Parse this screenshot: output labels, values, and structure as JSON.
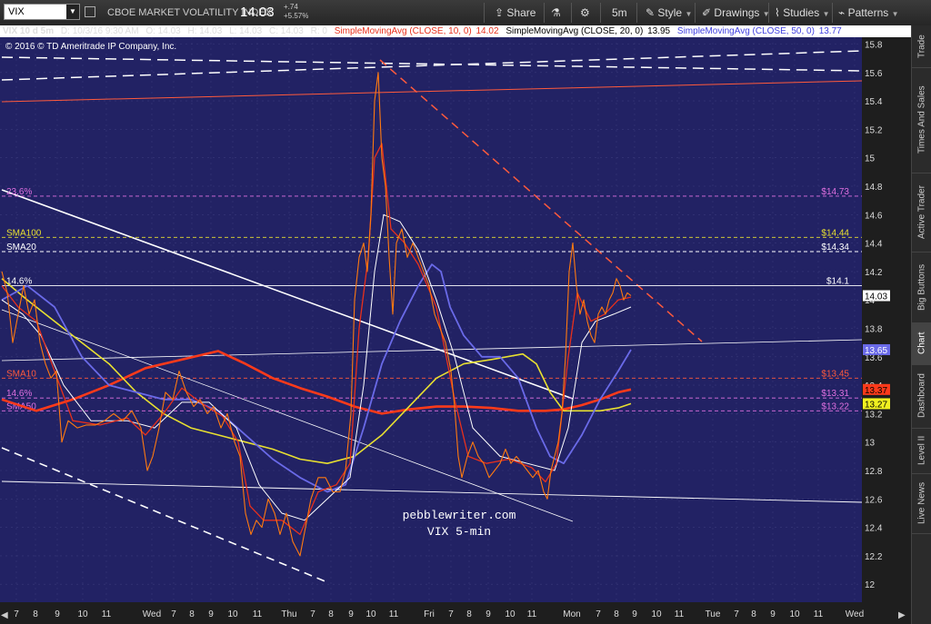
{
  "toolbar": {
    "symbol": "VIX",
    "description": "CBOE MARKET VOLATILITY INDEX",
    "last": "14.03",
    "change": "+.74",
    "change_pct": "+5.57%",
    "share": "Share",
    "timeframe": "5m",
    "style": "Style",
    "drawings": "Drawings",
    "studies": "Studies",
    "patterns": "Patterns"
  },
  "infobar": {
    "symbol": "VIX 10 d 5m",
    "date": "D: 10/3/16 9:30 AM",
    "open": "O: 14.03",
    "high": "H: 14.03",
    "low": "L: 14.03",
    "close": "C: 14.03",
    "r": "R: 0",
    "sma10": "SimpleMovingAvg (CLOSE, 10, 0)",
    "sma10_val": "14.02",
    "sma20": "SimpleMovingAvg (CLOSE, 20, 0)",
    "sma20_val": "13.95",
    "sma50": "SimpleMovingAvg (CLOSE, 50, 0)",
    "sma50_val": "13.77"
  },
  "copyright": "© 2016 © TD Ameritrade IP Company, Inc.",
  "watermark": {
    "line1": "pebblewriter.com",
    "line2": "VIX 5-min"
  },
  "chart_data": {
    "type": "line",
    "y_ticks": [
      "15.8",
      "15.6",
      "15.4",
      "15.2",
      "15",
      "14.8",
      "14.6",
      "14.4",
      "14.2",
      "14",
      "13.8",
      "13.6",
      "13.4",
      "13.2",
      "13",
      "12.8",
      "12.6",
      "12.4",
      "12.2",
      "12"
    ],
    "x_labels": [
      {
        "t": "7",
        "pos": 18
      },
      {
        "t": "8",
        "pos": 39
      },
      {
        "t": "9",
        "pos": 63
      },
      {
        "t": "10",
        "pos": 91
      },
      {
        "t": "11",
        "pos": 117
      },
      {
        "t": "Wed",
        "pos": 167
      },
      {
        "t": "7",
        "pos": 191
      },
      {
        "t": "8",
        "pos": 211
      },
      {
        "t": "9",
        "pos": 232
      },
      {
        "t": "10",
        "pos": 256
      },
      {
        "t": "11",
        "pos": 283
      },
      {
        "t": "Thu",
        "pos": 318
      },
      {
        "t": "7",
        "pos": 344
      },
      {
        "t": "8",
        "pos": 364
      },
      {
        "t": "9",
        "pos": 386
      },
      {
        "t": "10",
        "pos": 408
      },
      {
        "t": "11",
        "pos": 433
      },
      {
        "t": "Fri",
        "pos": 472
      },
      {
        "t": "7",
        "pos": 496
      },
      {
        "t": "8",
        "pos": 516
      },
      {
        "t": "9",
        "pos": 537
      },
      {
        "t": "10",
        "pos": 561
      },
      {
        "t": "11",
        "pos": 585
      },
      {
        "t": "Mon",
        "pos": 629
      },
      {
        "t": "7",
        "pos": 658
      },
      {
        "t": "8",
        "pos": 678
      },
      {
        "t": "9",
        "pos": 698
      },
      {
        "t": "10",
        "pos": 722
      },
      {
        "t": "11",
        "pos": 747
      },
      {
        "t": "Tue",
        "pos": 784
      },
      {
        "t": "7",
        "pos": 810
      },
      {
        "t": "8",
        "pos": 829
      },
      {
        "t": "9",
        "pos": 850
      },
      {
        "t": "10",
        "pos": 874
      },
      {
        "t": "11",
        "pos": 900
      },
      {
        "t": "Wed",
        "pos": 940
      }
    ],
    "levels": [
      {
        "label": "23.6%",
        "value": 14.73,
        "value_label": "$14.73",
        "color": "#e070e0"
      },
      {
        "label": "SMA100",
        "value": 14.44,
        "value_label": "$14.44",
        "color": "#e8e030"
      },
      {
        "label": "SMA20",
        "value": 14.34,
        "value_label": "$14.34",
        "color": "#ffffff"
      },
      {
        "label": "14.6%",
        "value": 14.1,
        "value_label": "$14.1",
        "color": "#ffffff"
      },
      {
        "label": "SMA10",
        "value": 13.45,
        "value_label": "$13.45",
        "color": "#ff5a3c"
      },
      {
        "label": "14.6%",
        "value": 13.31,
        "value_label": "$13.31",
        "color": "#e070e0"
      },
      {
        "label": "SMA50",
        "value": 13.22,
        "value_label": "$13.22",
        "color": "#e070e0"
      }
    ],
    "badges": [
      {
        "value": 14.03,
        "label": "14.03",
        "bg": "#ffffff",
        "fg": "#000000"
      },
      {
        "value": 13.65,
        "label": "13.65",
        "bg": "#6a6ae8",
        "fg": "#ffffff"
      },
      {
        "value": 13.37,
        "label": "13.37",
        "bg": "#ff3a1a",
        "fg": "#000000"
      },
      {
        "value": 13.27,
        "label": "13.27",
        "bg": "#f0f020",
        "fg": "#000000"
      }
    ],
    "price": [
      [
        2,
        14.2
      ],
      [
        8,
        14.05
      ],
      [
        14,
        13.7
      ],
      [
        20,
        13.9
      ],
      [
        26,
        14.1
      ],
      [
        32,
        13.9
      ],
      [
        38,
        14
      ],
      [
        44,
        13.7
      ],
      [
        50,
        13.55
      ],
      [
        56,
        13.45
      ],
      [
        62,
        13.5
      ],
      [
        68,
        13.0
      ],
      [
        75,
        13.15
      ],
      [
        85,
        13.1
      ],
      [
        95,
        13.12
      ],
      [
        105,
        13.12
      ],
      [
        115,
        13.15
      ],
      [
        125,
        13.2
      ],
      [
        135,
        13.15
      ],
      [
        145,
        13.22
      ],
      [
        155,
        13.1
      ],
      [
        162,
        12.8
      ],
      [
        168,
        12.9
      ],
      [
        175,
        13.1
      ],
      [
        182,
        13.35
      ],
      [
        190,
        13.3
      ],
      [
        197,
        13.5
      ],
      [
        205,
        13.35
      ],
      [
        213,
        13.25
      ],
      [
        220,
        13.3
      ],
      [
        228,
        13.2
      ],
      [
        235,
        13.25
      ],
      [
        243,
        13.1
      ],
      [
        250,
        13.2
      ],
      [
        258,
        13.0
      ],
      [
        264,
        12.9
      ],
      [
        270,
        12.5
      ],
      [
        276,
        12.35
      ],
      [
        282,
        12.45
      ],
      [
        288,
        12.4
      ],
      [
        295,
        12.6
      ],
      [
        302,
        12.5
      ],
      [
        308,
        12.35
      ],
      [
        315,
        12.5
      ],
      [
        322,
        12.3
      ],
      [
        330,
        12.2
      ],
      [
        336,
        12.4
      ],
      [
        342,
        12.6
      ],
      [
        350,
        12.75
      ],
      [
        358,
        12.75
      ],
      [
        366,
        12.65
      ],
      [
        374,
        12.65
      ],
      [
        380,
        12.8
      ],
      [
        386,
        13.2
      ],
      [
        390,
        14.0
      ],
      [
        395,
        14.3
      ],
      [
        400,
        14.4
      ],
      [
        404,
        14.2
      ],
      [
        408,
        14.6
      ],
      [
        412,
        15.4
      ],
      [
        416,
        15.6
      ],
      [
        420,
        15.0
      ],
      [
        424,
        14.8
      ],
      [
        428,
        14.3
      ],
      [
        432,
        13.9
      ],
      [
        436,
        14.4
      ],
      [
        442,
        14.5
      ],
      [
        448,
        14.3
      ],
      [
        454,
        14.4
      ],
      [
        460,
        14.3
      ],
      [
        466,
        14.2
      ],
      [
        472,
        14.1
      ],
      [
        478,
        13.9
      ],
      [
        484,
        13.8
      ],
      [
        490,
        13.7
      ],
      [
        496,
        13.5
      ],
      [
        500,
        13.25
      ],
      [
        504,
        12.9
      ],
      [
        508,
        12.75
      ],
      [
        514,
        12.9
      ],
      [
        520,
        13.0
      ],
      [
        526,
        12.9
      ],
      [
        532,
        12.85
      ],
      [
        538,
        12.75
      ],
      [
        544,
        12.8
      ],
      [
        550,
        12.85
      ],
      [
        556,
        12.95
      ],
      [
        562,
        12.85
      ],
      [
        568,
        12.9
      ],
      [
        574,
        12.85
      ],
      [
        580,
        12.8
      ],
      [
        586,
        12.75
      ],
      [
        592,
        12.8
      ],
      [
        598,
        12.65
      ],
      [
        602,
        12.6
      ],
      [
        606,
        12.8
      ],
      [
        610,
        12.9
      ],
      [
        614,
        13.0
      ],
      [
        618,
        13.2
      ],
      [
        622,
        13.6
      ],
      [
        626,
        14.2
      ],
      [
        630,
        14.4
      ],
      [
        634,
        14.1
      ],
      [
        638,
        13.9
      ],
      [
        642,
        14.0
      ],
      [
        646,
        13.85
      ],
      [
        650,
        13.75
      ],
      [
        654,
        13.7
      ],
      [
        658,
        13.9
      ],
      [
        662,
        13.95
      ],
      [
        666,
        13.9
      ],
      [
        670,
        14.0
      ],
      [
        674,
        14.05
      ],
      [
        678,
        14.15
      ],
      [
        682,
        14.1
      ],
      [
        686,
        14.0
      ],
      [
        690,
        14.05
      ],
      [
        694,
        14.03
      ]
    ],
    "sma10": [
      [
        2,
        14.1
      ],
      [
        20,
        13.95
      ],
      [
        40,
        13.85
      ],
      [
        60,
        13.5
      ],
      [
        80,
        13.15
      ],
      [
        110,
        13.12
      ],
      [
        140,
        13.17
      ],
      [
        160,
        13.05
      ],
      [
        180,
        13.2
      ],
      [
        200,
        13.38
      ],
      [
        220,
        13.28
      ],
      [
        245,
        13.18
      ],
      [
        262,
        13.0
      ],
      [
        275,
        12.55
      ],
      [
        290,
        12.45
      ],
      [
        310,
        12.45
      ],
      [
        330,
        12.35
      ],
      [
        350,
        12.65
      ],
      [
        370,
        12.7
      ],
      [
        385,
        12.85
      ],
      [
        395,
        13.8
      ],
      [
        405,
        14.3
      ],
      [
        412,
        15.0
      ],
      [
        420,
        15.1
      ],
      [
        430,
        14.5
      ],
      [
        445,
        14.4
      ],
      [
        460,
        14.25
      ],
      [
        480,
        13.95
      ],
      [
        500,
        13.3
      ],
      [
        515,
        12.9
      ],
      [
        535,
        12.85
      ],
      [
        560,
        12.88
      ],
      [
        585,
        12.82
      ],
      [
        600,
        12.72
      ],
      [
        612,
        12.85
      ],
      [
        625,
        13.6
      ],
      [
        635,
        14.05
      ],
      [
        650,
        13.85
      ],
      [
        665,
        13.9
      ],
      [
        680,
        14.0
      ],
      [
        694,
        14.02
      ]
    ],
    "sma20": [
      [
        2,
        14.0
      ],
      [
        25,
        13.9
      ],
      [
        45,
        13.75
      ],
      [
        70,
        13.4
      ],
      [
        100,
        13.15
      ],
      [
        140,
        13.15
      ],
      [
        170,
        13.1
      ],
      [
        200,
        13.28
      ],
      [
        230,
        13.28
      ],
      [
        260,
        13.1
      ],
      [
        285,
        12.7
      ],
      [
        310,
        12.5
      ],
      [
        335,
        12.45
      ],
      [
        360,
        12.6
      ],
      [
        385,
        12.75
      ],
      [
        400,
        13.4
      ],
      [
        412,
        14.2
      ],
      [
        422,
        14.6
      ],
      [
        440,
        14.55
      ],
      [
        460,
        14.35
      ],
      [
        480,
        14.0
      ],
      [
        500,
        13.6
      ],
      [
        520,
        13.1
      ],
      [
        550,
        12.9
      ],
      [
        580,
        12.85
      ],
      [
        610,
        12.8
      ],
      [
        625,
        13.1
      ],
      [
        640,
        13.7
      ],
      [
        655,
        13.85
      ],
      [
        675,
        13.9
      ],
      [
        694,
        13.95
      ]
    ],
    "sma50": [
      [
        2,
        14.0
      ],
      [
        30,
        14.1
      ],
      [
        60,
        13.95
      ],
      [
        90,
        13.6
      ],
      [
        120,
        13.4
      ],
      [
        150,
        13.35
      ],
      [
        180,
        13.3
      ],
      [
        210,
        13.3
      ],
      [
        240,
        13.22
      ],
      [
        270,
        13.05
      ],
      [
        300,
        12.88
      ],
      [
        330,
        12.75
      ],
      [
        360,
        12.65
      ],
      [
        380,
        12.7
      ],
      [
        400,
        13.1
      ],
      [
        420,
        13.55
      ],
      [
        440,
        13.85
      ],
      [
        460,
        14.1
      ],
      [
        475,
        14.25
      ],
      [
        485,
        14.2
      ],
      [
        495,
        13.95
      ],
      [
        510,
        13.75
      ],
      [
        530,
        13.6
      ],
      [
        550,
        13.6
      ],
      [
        570,
        13.45
      ],
      [
        590,
        13.1
      ],
      [
        605,
        12.9
      ],
      [
        620,
        12.85
      ],
      [
        640,
        13.05
      ],
      [
        660,
        13.3
      ],
      [
        680,
        13.5
      ],
      [
        694,
        13.65
      ]
    ],
    "sma100": [
      [
        2,
        14.15
      ],
      [
        30,
        14.0
      ],
      [
        60,
        13.85
      ],
      [
        90,
        13.7
      ],
      [
        120,
        13.55
      ],
      [
        150,
        13.35
      ],
      [
        180,
        13.2
      ],
      [
        210,
        13.1
      ],
      [
        240,
        13.05
      ],
      [
        270,
        13.0
      ],
      [
        300,
        12.95
      ],
      [
        330,
        12.88
      ],
      [
        360,
        12.85
      ],
      [
        390,
        12.9
      ],
      [
        420,
        13.05
      ],
      [
        450,
        13.25
      ],
      [
        480,
        13.45
      ],
      [
        510,
        13.55
      ],
      [
        540,
        13.58
      ],
      [
        575,
        13.62
      ],
      [
        590,
        13.55
      ],
      [
        605,
        13.35
      ],
      [
        620,
        13.22
      ],
      [
        640,
        13.22
      ],
      [
        660,
        13.22
      ],
      [
        680,
        13.24
      ],
      [
        694,
        13.27
      ]
    ],
    "sma200": [
      [
        2,
        13.3
      ],
      [
        40,
        13.22
      ],
      [
        80,
        13.3
      ],
      [
        120,
        13.4
      ],
      [
        160,
        13.52
      ],
      [
        200,
        13.58
      ],
      [
        240,
        13.64
      ],
      [
        270,
        13.55
      ],
      [
        300,
        13.45
      ],
      [
        330,
        13.38
      ],
      [
        360,
        13.32
      ],
      [
        390,
        13.25
      ],
      [
        420,
        13.2
      ],
      [
        450,
        13.23
      ],
      [
        480,
        13.25
      ],
      [
        510,
        13.25
      ],
      [
        540,
        13.24
      ],
      [
        570,
        13.22
      ],
      [
        600,
        13.22
      ],
      [
        620,
        13.23
      ],
      [
        640,
        13.26
      ],
      [
        660,
        13.3
      ],
      [
        680,
        13.35
      ],
      [
        694,
        13.37
      ]
    ]
  }
}
